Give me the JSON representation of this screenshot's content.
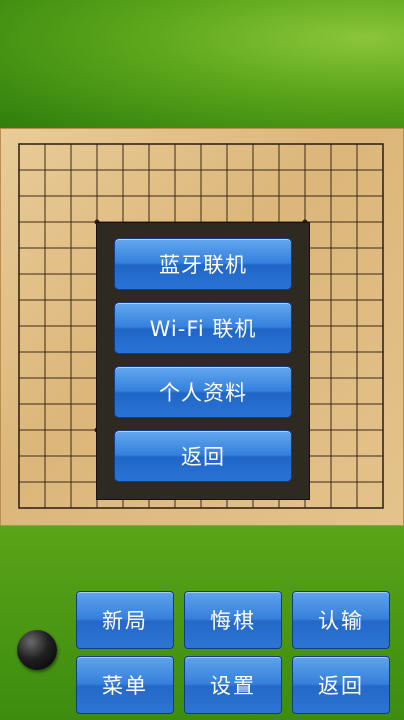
{
  "menu": {
    "bluetooth_label": "蓝牙联机",
    "wifi_label": "Wi-Fi 联机",
    "profile_label": "个人资料",
    "back_label": "返回"
  },
  "controls": {
    "new_game_label": "新局",
    "undo_label": "悔棋",
    "resign_label": "认输",
    "menu_label": "菜单",
    "settings_label": "设置",
    "back_label": "返回"
  },
  "board": {
    "size": 15
  },
  "player_stone": {
    "color": "black"
  }
}
